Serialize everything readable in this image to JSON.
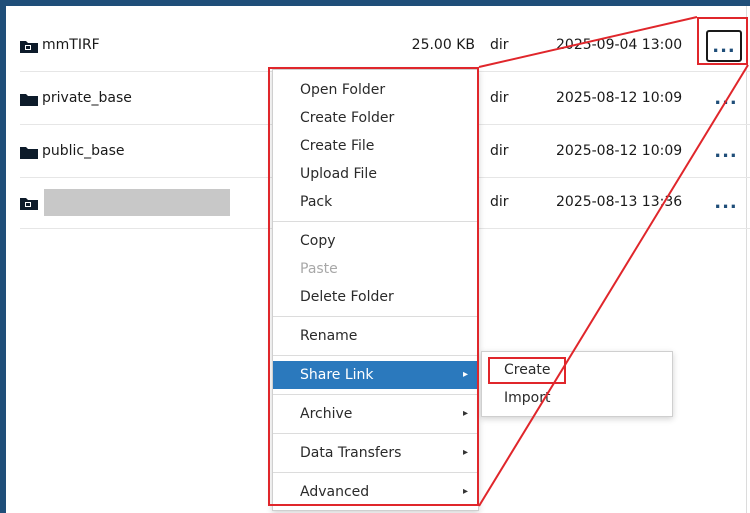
{
  "files": [
    {
      "name": "mmTIRF",
      "size": "25.00 KB",
      "type": "dir",
      "date": "2025-09-04 13:00",
      "icon": "shared-folder-icon",
      "redacted": false
    },
    {
      "name": "private_base",
      "size": "",
      "type": "dir",
      "date": "2025-08-12 10:09",
      "icon": "folder-icon",
      "redacted": false
    },
    {
      "name": "public_base",
      "size": "",
      "type": "dir",
      "date": "2025-08-12 10:09",
      "icon": "folder-icon",
      "redacted": false
    },
    {
      "name": "",
      "size": "",
      "type": "dir",
      "date": "2025-08-13 13:36",
      "icon": "shared-folder-icon",
      "redacted": true
    }
  ],
  "row_action_label": "...",
  "context_menu": {
    "group1": [
      "Open Folder",
      "Create Folder",
      "Create File",
      "Upload File",
      "Pack"
    ],
    "group2": [
      "Copy",
      "Paste",
      "Delete Folder"
    ],
    "group3": [
      "Rename"
    ],
    "share_link": "Share Link",
    "archive": "Archive",
    "data_transfers": "Data Transfers",
    "advanced": "Advanced",
    "disabled_item": "Paste"
  },
  "share_submenu": [
    "Create",
    "Import"
  ],
  "colors": {
    "frame": "#1f4e79",
    "highlight": "#2b79bd",
    "annotation": "#e0262b",
    "redaction": "#c8c8c8"
  }
}
